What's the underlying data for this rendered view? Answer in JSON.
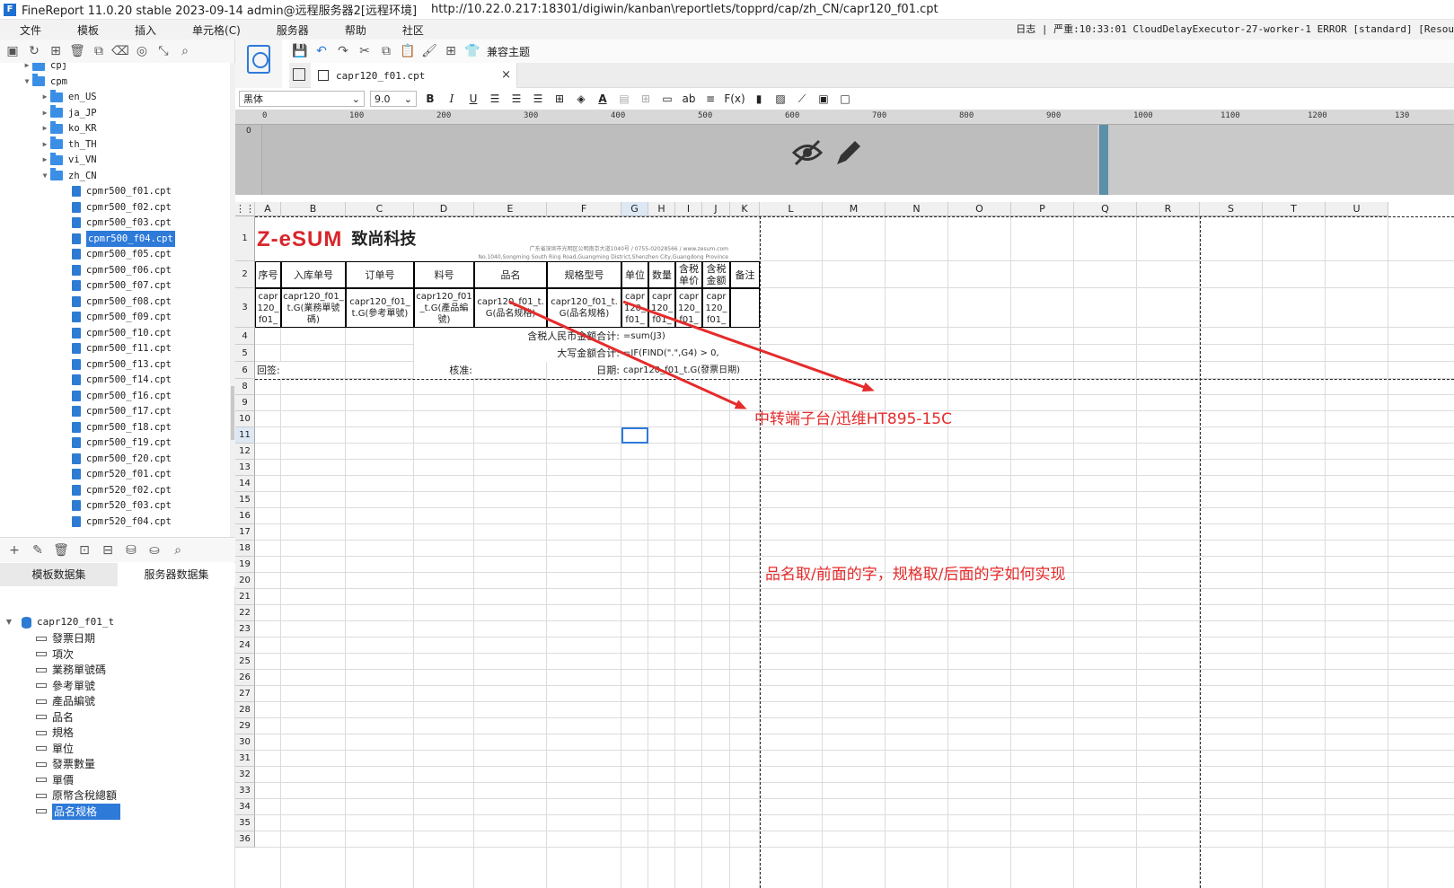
{
  "window": {
    "title": "FineReport 11.0.20 stable 2023-09-14 admin@远程服务器2[远程环境]",
    "url": "http://10.22.0.217:18301/digiwin/kanban\\reportlets/topprd/cap/zh_CN/capr120_f01.cpt"
  },
  "menu": {
    "items": [
      "文件",
      "模板",
      "插入",
      "单元格(C)",
      "服务器",
      "帮助",
      "社区"
    ],
    "log": "日志 | 严重:10:33:01 CloudDelayExecutor-27-worker-1 ERROR [standard] [Resou"
  },
  "tree": {
    "folders": [
      "cpj",
      "cpm",
      "en_US",
      "ja_JP",
      "ko_KR",
      "th_TH",
      "vi_VN",
      "zh_CN"
    ],
    "files": [
      "cpmr500_f01.cpt",
      "cpmr500_f02.cpt",
      "cpmr500_f03.cpt",
      "cpmr500_f04.cpt",
      "cpmr500_f05.cpt",
      "cpmr500_f06.cpt",
      "cpmr500_f07.cpt",
      "cpmr500_f08.cpt",
      "cpmr500_f09.cpt",
      "cpmr500_f10.cpt",
      "cpmr500_f11.cpt",
      "cpmr500_f13.cpt",
      "cpmr500_f14.cpt",
      "cpmr500_f16.cpt",
      "cpmr500_f17.cpt",
      "cpmr500_f18.cpt",
      "cpmr500_f19.cpt",
      "cpmr500_f20.cpt",
      "cpmr520_f01.cpt",
      "cpmr520_f02.cpt",
      "cpmr520_f03.cpt",
      "cpmr520_f04.cpt"
    ],
    "selected_file": "cpmr500_f04.cpt"
  },
  "datasets": {
    "tabs": [
      "模板数据集",
      "服务器数据集"
    ],
    "dataset_name": "capr120_f01_t",
    "fields": [
      "發票日期",
      "項次",
      "業務單號碼",
      "參考單號",
      "產品編號",
      "品名",
      "規格",
      "單位",
      "發票數量",
      "單價",
      "原幣含稅總額",
      "品名规格"
    ],
    "selected_field": "品名规格"
  },
  "toolbar": {
    "compat_theme": "兼容主题"
  },
  "doc_tab": {
    "name": "capr120_f01.cpt",
    "close": "×"
  },
  "format": {
    "font": "黑体",
    "size": "9.0",
    "bold": "B",
    "italic": "I",
    "underline": "U",
    "fx": "F(x)",
    "ab": "ab"
  },
  "ruler": {
    "ticks": [
      "0",
      "100",
      "200",
      "300",
      "400",
      "500",
      "600",
      "700",
      "800",
      "900",
      "1000",
      "1100",
      "1200",
      "130"
    ]
  },
  "vruler": {
    "zero": "0"
  },
  "columns": [
    "A",
    "B",
    "C",
    "D",
    "E",
    "F",
    "G",
    "H",
    "I",
    "J",
    "K",
    "L",
    "M",
    "N",
    "O",
    "P",
    "Q",
    "R",
    "S",
    "T",
    "U"
  ],
  "rows": [
    "1",
    "2",
    "3",
    "4",
    "5",
    "6",
    "8",
    "9",
    "10",
    "11",
    "12",
    "13",
    "14",
    "15",
    "16",
    "17",
    "18",
    "19",
    "20",
    "21",
    "22",
    "23",
    "24",
    "25",
    "26",
    "27",
    "28",
    "29",
    "30",
    "31",
    "32",
    "33",
    "34",
    "35",
    "36"
  ],
  "report": {
    "logo_text": "Z-eSUM",
    "company": "致尚科技",
    "address_cn": "广东省深圳市光明区公明南京大道1040号  /  0755-02028566  /  www.zesum.com",
    "address_en": "No.1040,Songming South Ring Road,Guangming District,Shenzhen City,Guangdong Province",
    "headers": [
      "序号",
      "入库单号",
      "订单号",
      "料号",
      "品名",
      "规格型号",
      "单位",
      "数量",
      "含税单价",
      "含税金额",
      "备注"
    ],
    "row3": [
      "capr120_f01_",
      "capr120_f01_t.G(業務單號碼)",
      "capr120_f01_t.G(參考單號)",
      "capr120_f01_t.G(產品編號)",
      "capr120_f01_t.G(品名规格)",
      "capr120_f01_t.G(品名规格)",
      "capr120_f01_",
      "capr120_f01_",
      "capr120_f01_",
      "capr120_f01_"
    ],
    "r4_label": "含税人民币金额合计:",
    "r4_value": "=sum(J3)",
    "r5_label": "大写金额合计:",
    "r5_value": "=IF(FIND(\".\",G4) > 0,",
    "r6_sign": "回签:",
    "r6_check": "核准:",
    "r6_date_label": "日期:",
    "r6_date_value": "capr120_f01_t.G(發票日期)"
  },
  "annotations": {
    "arrow_note": "中转端子台/迅维HT895-15C",
    "question": "品名取/前面的字，规格取/后面的字如何实现",
    "color": "#e52b2b"
  }
}
